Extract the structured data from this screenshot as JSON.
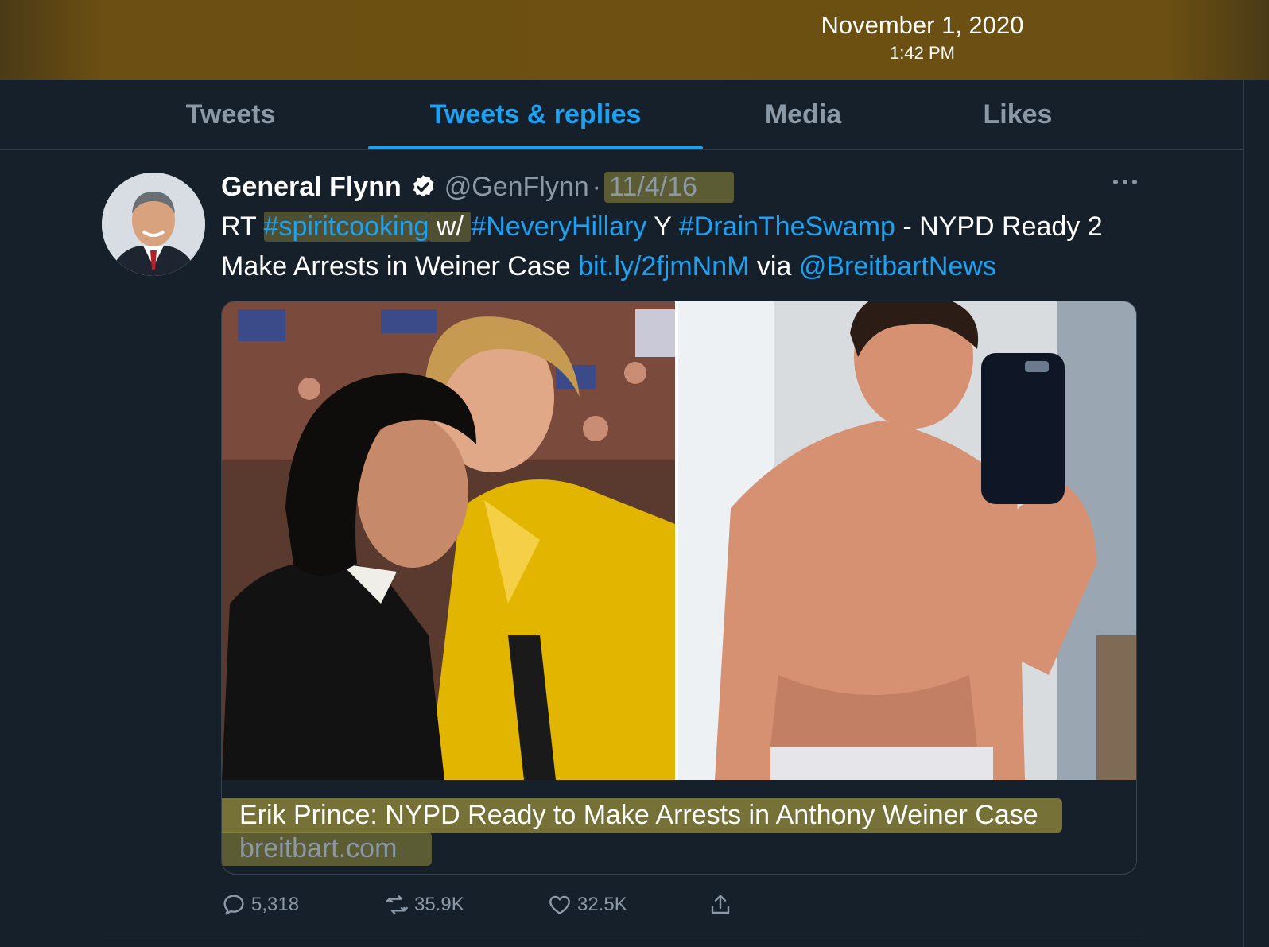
{
  "status": {
    "date": "November 1, 2020",
    "time": "1:42 PM"
  },
  "tabs": [
    {
      "label": "Tweets",
      "active": false
    },
    {
      "label": "Tweets & replies",
      "active": true
    },
    {
      "label": "Media",
      "active": false
    },
    {
      "label": "Likes",
      "active": false
    }
  ],
  "tweet": {
    "name": "General Flynn",
    "handle": "@GenFlynn",
    "separator": "·",
    "date": "11/4/16",
    "more_icon": "more-options-icon",
    "text": {
      "t1": "RT ",
      "h1": "#spiritcooking",
      "t2": " w/ ",
      "h2": "#NeveryHillary",
      "t3": " Y ",
      "h3": "#DrainTheSwamp",
      "t4": " - NYPD Ready 2 Make Arrests in Weiner Case ",
      "url": "bit.ly/2fjmNnM",
      "t5": " via ",
      "mention": "@BreitbartNews"
    },
    "card": {
      "title": "Erik Prince: NYPD Ready to Make Arrests in Anthony Weiner Case",
      "domain": "breitbart.com"
    },
    "actions": {
      "replies": "5,318",
      "retweets": "35.9K",
      "likes": "32.5K"
    }
  },
  "colors": {
    "background": "#15202b",
    "accent": "#1da1f2",
    "muted": "#8b98a5",
    "highlight": "#968c3c",
    "topbar": "#6d5012"
  }
}
